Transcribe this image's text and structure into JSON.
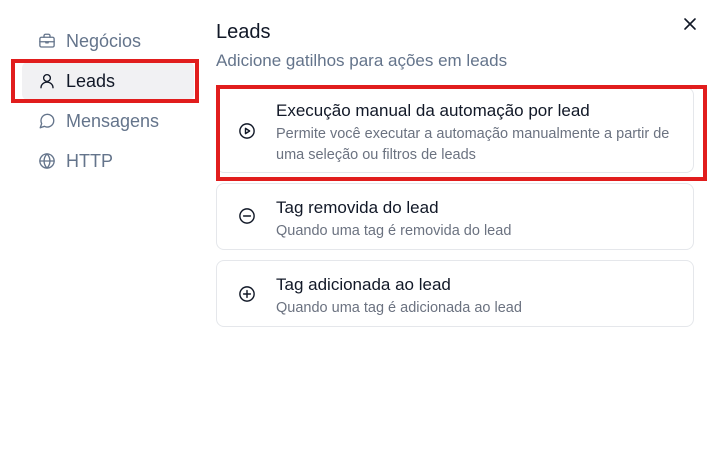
{
  "sidebar": {
    "items": [
      {
        "label": "Negócios",
        "icon": "briefcase-icon"
      },
      {
        "label": "Leads",
        "icon": "user-icon",
        "active": true
      },
      {
        "label": "Mensagens",
        "icon": "message-icon"
      },
      {
        "label": "HTTP",
        "icon": "globe-icon"
      }
    ]
  },
  "main": {
    "title": "Leads",
    "subtitle": "Adicione gatilhos para ações em leads",
    "close_icon": "close-icon",
    "cards": [
      {
        "title": "Execução manual da automação por lead",
        "description": "Permite você executar a automação manualmente a partir de uma seleção ou filtros de leads",
        "icon": "play-circle-icon"
      },
      {
        "title": "Tag removida do lead",
        "description": "Quando uma tag é removida do lead",
        "icon": "minus-circle-icon"
      },
      {
        "title": "Tag adicionada ao lead",
        "description": "Quando uma tag é adicionada ao lead",
        "icon": "plus-circle-icon"
      }
    ]
  },
  "colors": {
    "highlight": "#e11d1d",
    "active_bg": "#f1f1f3",
    "muted_text": "#64748b"
  }
}
